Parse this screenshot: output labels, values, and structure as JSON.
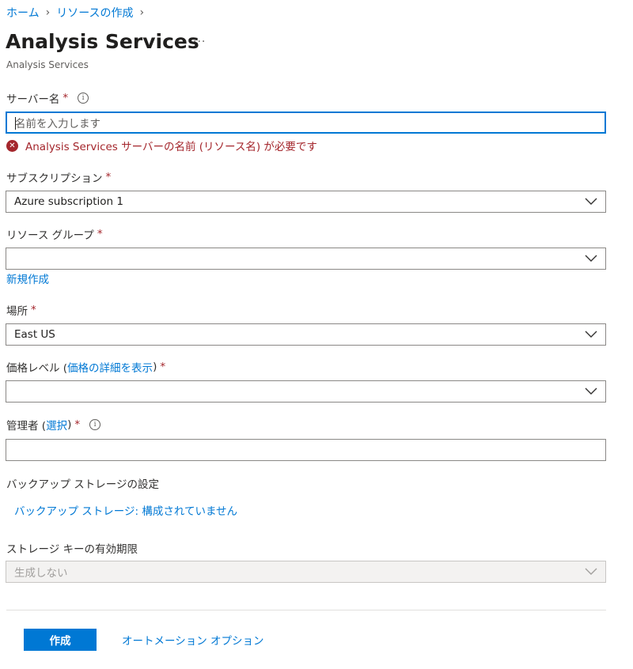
{
  "breadcrumb": {
    "home": "ホーム",
    "create_resource": "リソースの作成"
  },
  "header": {
    "title": "Analysis Services",
    "more": "···",
    "subtitle": "Analysis Services"
  },
  "form": {
    "server_name": {
      "label": "サーバー名",
      "required": "*",
      "placeholder": "名前を入力します",
      "value": "",
      "error": "Analysis Services サーバーの名前 (リソース名) が必要です"
    },
    "subscription": {
      "label": "サブスクリプション",
      "required": "*",
      "value": "Azure subscription 1"
    },
    "resource_group": {
      "label": "リソース グループ",
      "required": "*",
      "value": "",
      "create_new": "新規作成"
    },
    "location": {
      "label": "場所",
      "required": "*",
      "value": "East US"
    },
    "pricing_tier": {
      "label_prefix": "価格レベル (",
      "label_link": "価格の詳細を表示",
      "label_suffix": ")",
      "required": "*",
      "value": ""
    },
    "admin": {
      "label_prefix": "管理者 (",
      "label_link": "選択",
      "label_suffix": ")",
      "required": "*",
      "value": ""
    },
    "backup": {
      "label": "バックアップ ストレージの設定",
      "link": "バックアップ ストレージ: 構成されていません"
    },
    "storage_key": {
      "label": "ストレージ キーの有効期限",
      "value": "生成しない"
    }
  },
  "footer": {
    "create_label": "作成",
    "automation_label": "オートメーション オプション"
  },
  "colors": {
    "accent": "#0078d4",
    "error": "#a4262c",
    "border": "#8a8886"
  }
}
